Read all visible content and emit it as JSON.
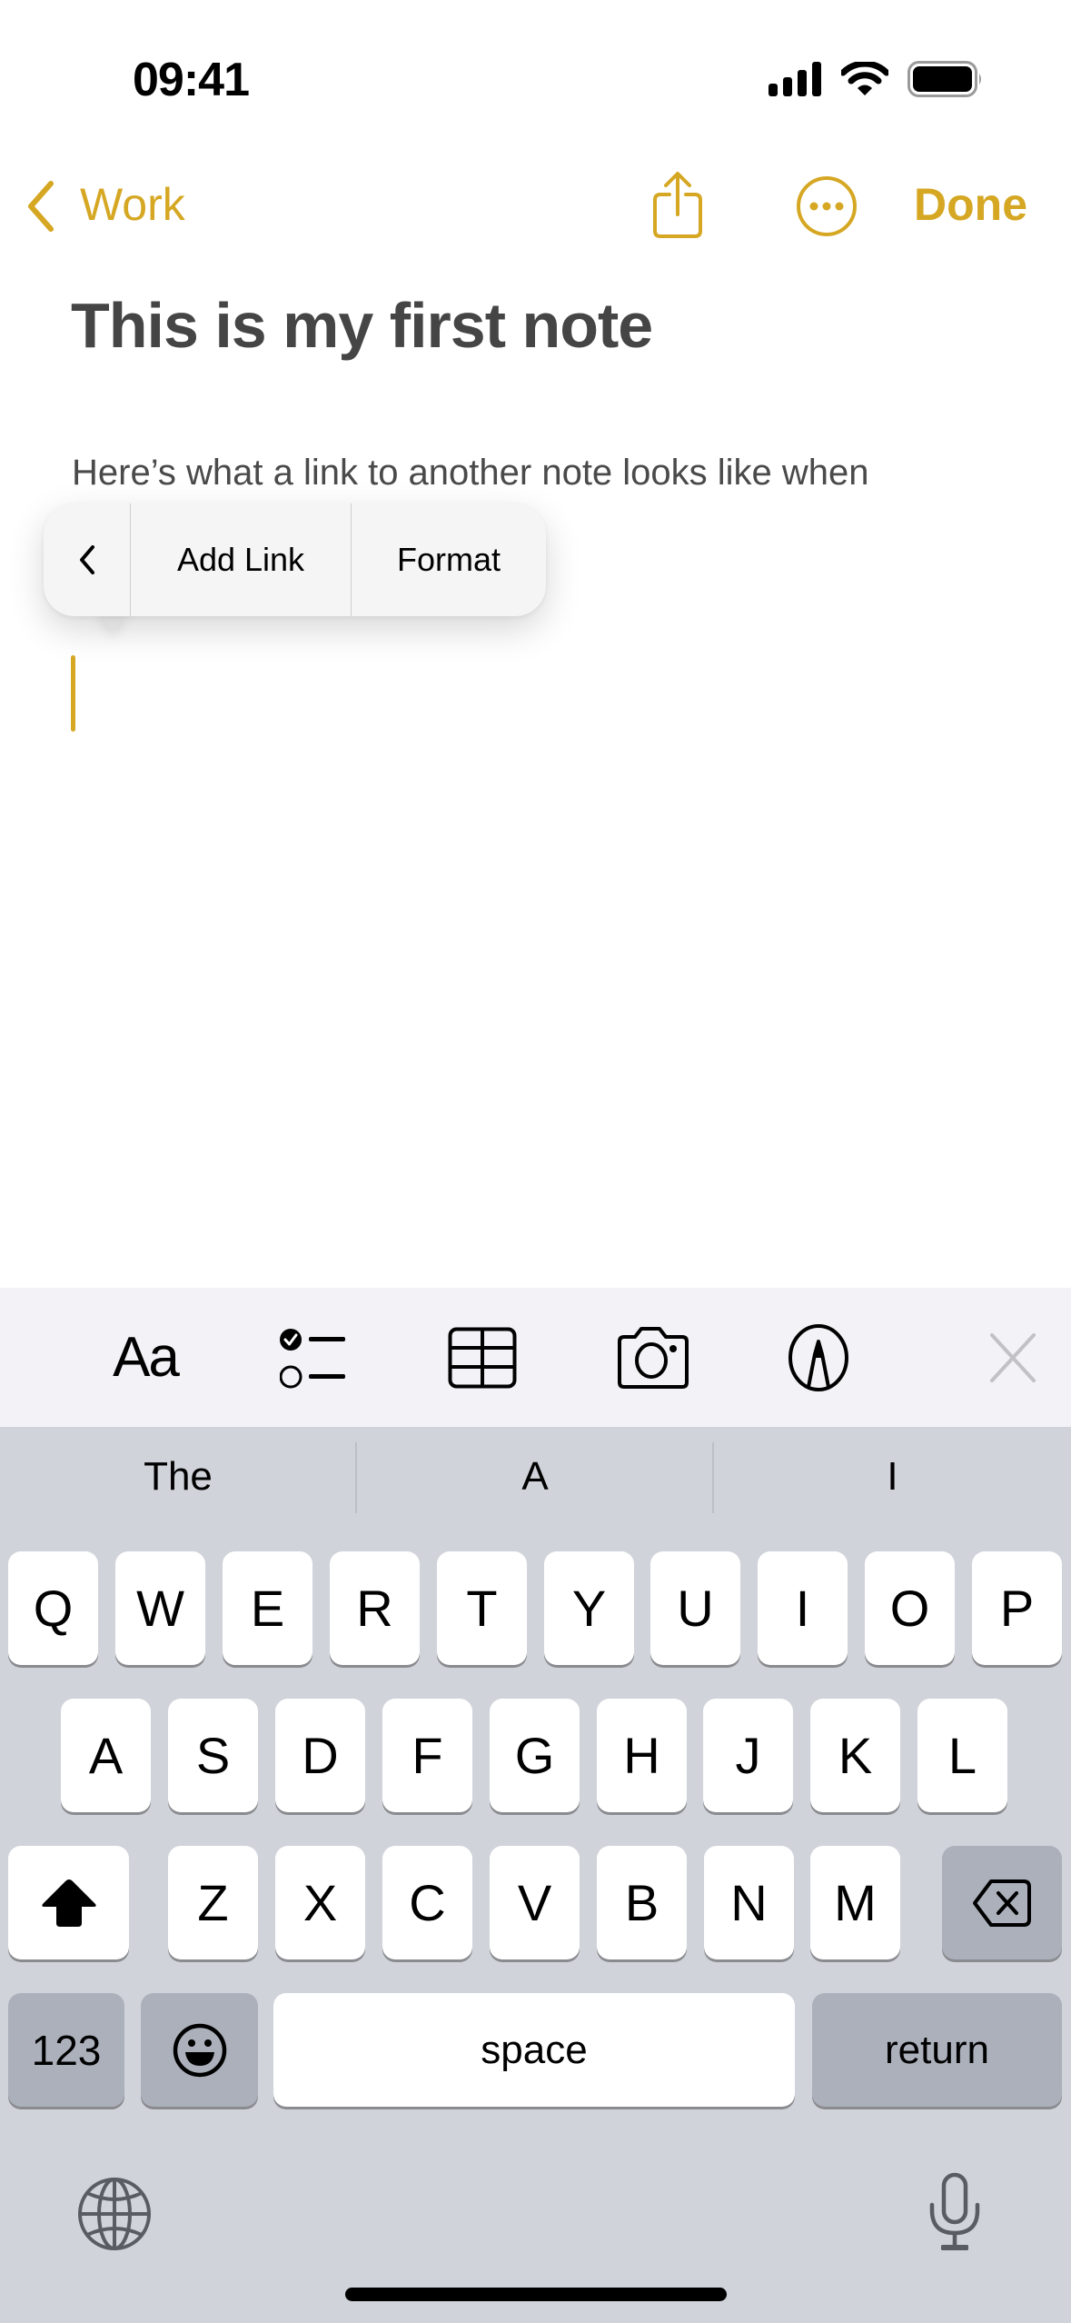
{
  "status_bar": {
    "time": "09:41",
    "icons": [
      "cellular-signal-icon",
      "wifi-icon",
      "battery-icon"
    ]
  },
  "nav": {
    "back_label": "Work",
    "back_icon": "chevron-left-icon",
    "share_icon": "share-icon",
    "more_icon": "ellipsis-circle-icon",
    "done_label": "Done",
    "accent_color": "#d5a723"
  },
  "note": {
    "title": "This is my first note",
    "body": "Here’s what a link to another note looks like when"
  },
  "edit_menu": {
    "back_icon": "chevron-left-icon",
    "items": [
      {
        "label": "Add Link"
      },
      {
        "label": "Format"
      }
    ]
  },
  "format_toolbar": {
    "text_style_label": "Aa",
    "items": [
      "text-format-icon",
      "checklist-icon",
      "table-icon",
      "camera-icon",
      "markup-icon",
      "close-icon"
    ]
  },
  "keyboard": {
    "suggestions": [
      "The",
      "A",
      "I"
    ],
    "rows": [
      [
        "Q",
        "W",
        "E",
        "R",
        "T",
        "Y",
        "U",
        "I",
        "O",
        "P"
      ],
      [
        "A",
        "S",
        "D",
        "F",
        "G",
        "H",
        "J",
        "K",
        "L"
      ],
      [
        "Z",
        "X",
        "C",
        "V",
        "B",
        "N",
        "M"
      ]
    ],
    "numbers_label": "123",
    "space_label": "space",
    "return_label": "return",
    "bottom_icons": [
      "globe-icon",
      "microphone-icon"
    ]
  }
}
